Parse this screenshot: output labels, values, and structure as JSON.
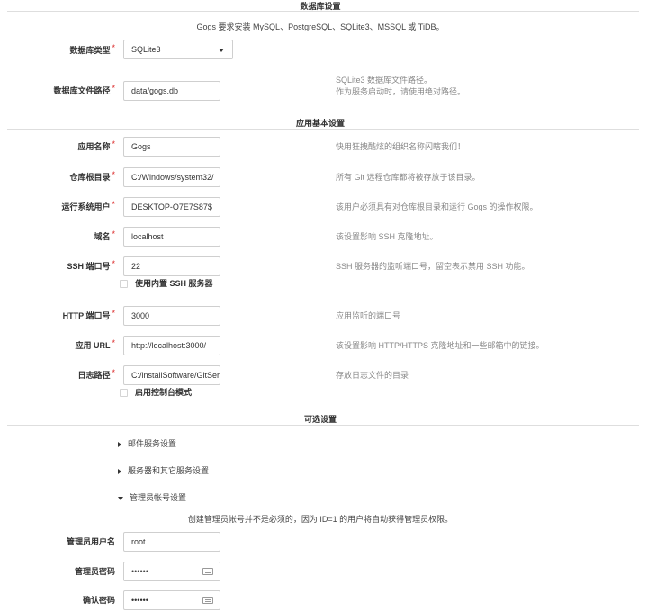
{
  "database": {
    "section_title": "数据库设置",
    "intro": "Gogs 要求安装 MySQL、PostgreSQL、SQLite3、MSSQL 或 TiDB。",
    "type_label": "数据库类型",
    "type_value": "SQLite3",
    "path_label": "数据库文件路径",
    "path_value": "data/gogs.db",
    "path_help_1": "SQLite3 数据库文件路径。",
    "path_help_2": "作为服务启动时，请使用绝对路径。"
  },
  "app": {
    "section_title": "应用基本设置",
    "fields": [
      {
        "label": "应用名称",
        "value": "Gogs",
        "help": "快用狂拽酷炫的组织名称闪瞎我们！"
      },
      {
        "label": "仓库根目录",
        "value": "C:/Windows/system32/",
        "help": "所有 Git 远程仓库都将被存放于该目录。"
      },
      {
        "label": "运行系统用户",
        "value": "DESKTOP-O7E7S87$",
        "help": "该用户必须具有对仓库根目录和运行 Gogs 的操作权限。"
      },
      {
        "label": "域名",
        "value": "localhost",
        "help": "该设置影响 SSH 克隆地址。"
      },
      {
        "label": "SSH 端口号",
        "value": "22",
        "help": "SSH 服务器的监听端口号，留空表示禁用 SSH 功能。"
      },
      {
        "label": "HTTP 端口号",
        "value": "3000",
        "help": "应用监听的端口号"
      },
      {
        "label": "应用 URL",
        "value": "http://localhost:3000/",
        "help": "该设置影响 HTTP/HTTPS 克隆地址和一些邮箱中的链接。"
      },
      {
        "label": "日志路径",
        "value": "C:/installSoftware/GitServer/log",
        "help": "存放日志文件的目录"
      }
    ],
    "builtin_ssh_label": "使用内置 SSH 服务器",
    "console_mode_label": "启用控制台模式"
  },
  "optional": {
    "section_title": "可选设置",
    "mail_toggle": "邮件服务设置",
    "server_toggle": "服务器和其它服务设置",
    "admin_toggle": "管理员帐号设置",
    "admin_note": "创建管理员帐号并不是必须的，因为 ID=1 的用户将自动获得管理员权限。",
    "admin_username_label": "管理员用户名",
    "admin_username_value": "root",
    "admin_password_label": "管理员密码",
    "admin_password_value": "••••••",
    "confirm_password_label": "确认密码",
    "confirm_password_value": "••••••"
  }
}
